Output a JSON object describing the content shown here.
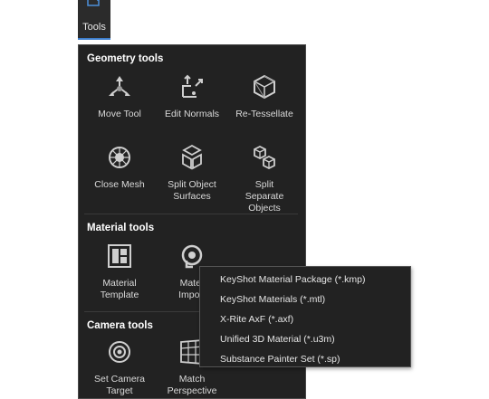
{
  "toolbar": {
    "tools_label": "Tools"
  },
  "geometry": {
    "title": "Geometry tools",
    "tools": [
      {
        "lines": [
          "Move Tool"
        ],
        "icon": "move-tool-icon"
      },
      {
        "lines": [
          "Edit Normals"
        ],
        "icon": "edit-normals-icon"
      },
      {
        "lines": [
          "Re-Tessellate"
        ],
        "icon": "re-tessellate-icon"
      },
      {
        "lines": [
          "Close Mesh"
        ],
        "icon": "close-mesh-icon"
      },
      {
        "lines": [
          "Split Object",
          "Surfaces"
        ],
        "icon": "split-object-surfaces-icon"
      },
      {
        "lines": [
          "Split",
          "Separate",
          "Objects"
        ],
        "icon": "split-separate-objects-icon"
      }
    ]
  },
  "material": {
    "title": "Material tools",
    "tools": [
      {
        "lines": [
          "Material",
          "Template"
        ],
        "icon": "material-template-icon"
      },
      {
        "lines": [
          "Mater",
          "Import"
        ],
        "icon": "material-import-icon"
      }
    ]
  },
  "camera": {
    "title": "Camera tools",
    "tools": [
      {
        "lines": [
          "Set Camera",
          "Target"
        ],
        "icon": "camera-target-icon"
      },
      {
        "lines": [
          "Match",
          "Perspective"
        ],
        "icon": "match-perspective-icon"
      }
    ]
  },
  "import_menu": {
    "items": [
      "KeyShot Material Package (*.kmp)",
      "KeyShot Materials (*.mtl)",
      "X-Rite AxF (*.axf)",
      "Unified 3D Material (*.u3m)",
      "Substance Painter Set (*.sp)"
    ]
  },
  "colors": {
    "panel_bg": "#222222",
    "accent": "#3d7ecc",
    "text": "#d9d9d9"
  }
}
